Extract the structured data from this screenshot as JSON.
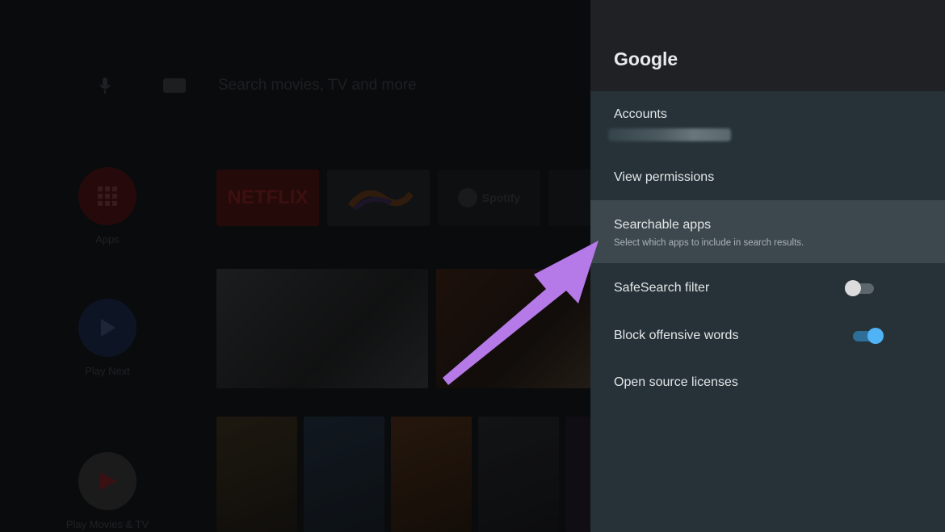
{
  "home": {
    "search_placeholder": "Search movies, TV and more",
    "side_apps": [
      {
        "label": "Apps",
        "icon": "apps-grid-icon",
        "color": "#3b1012"
      },
      {
        "label": "Play Next",
        "icon": "play-icon",
        "color": "#14213a"
      },
      {
        "label": "Play Movies & TV",
        "icon": "play-movies-icon",
        "color": "#2a2a2a"
      }
    ],
    "channels": [
      {
        "label": "NETFLIX",
        "color": "#3a1010"
      },
      {
        "label": "",
        "color": "#1a1c1f"
      },
      {
        "label": "Spotify",
        "color": "#15171a"
      }
    ]
  },
  "panel": {
    "title": "Google",
    "items": [
      {
        "title": "Accounts",
        "subtitle": ""
      },
      {
        "title": "View permissions",
        "subtitle": ""
      },
      {
        "title": "Searchable apps",
        "subtitle": "Select which apps to include in search results."
      },
      {
        "title": "SafeSearch filter",
        "toggle": "off"
      },
      {
        "title": "Block offensive words",
        "toggle": "on"
      },
      {
        "title": "Open source licenses",
        "subtitle": ""
      }
    ]
  },
  "colors": {
    "panel_bg": "#263238",
    "header_bg": "#1f2124",
    "highlight_bg": "#3d484e",
    "toggle_on": "#4fb3f6",
    "toggle_off": "#dcdcdc",
    "arrow": "#b57ae8"
  }
}
